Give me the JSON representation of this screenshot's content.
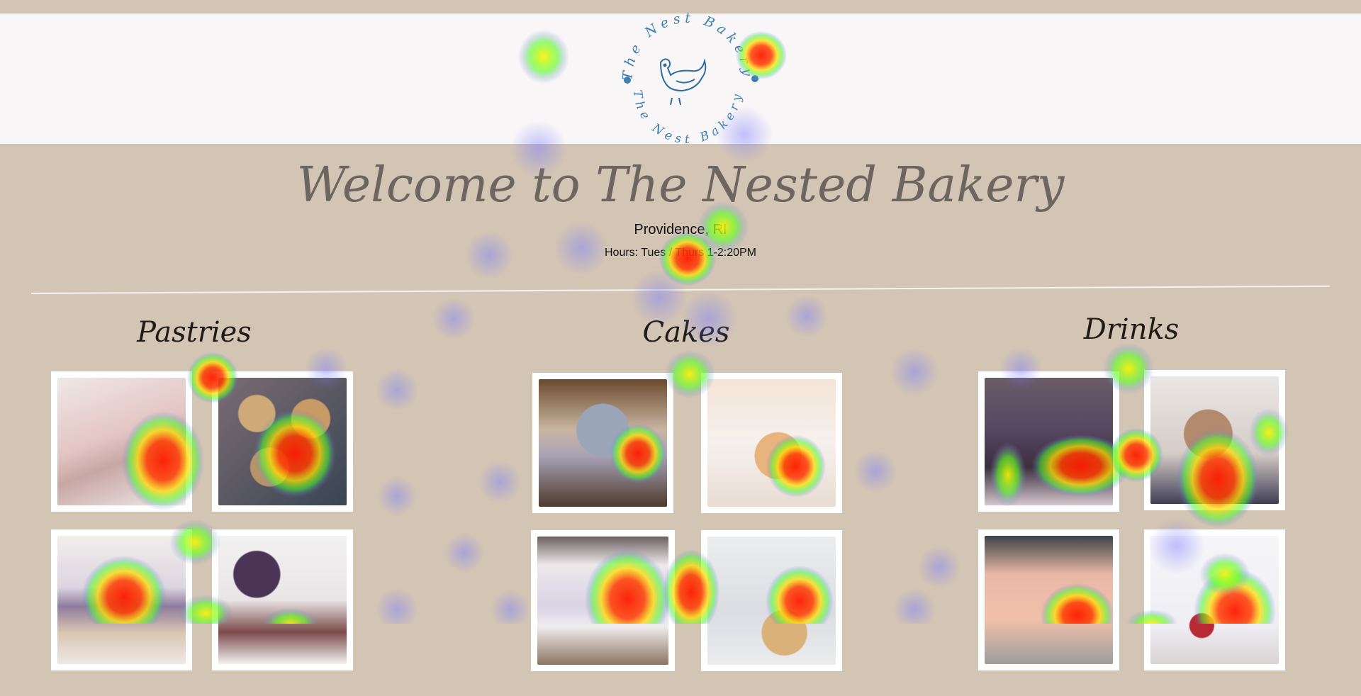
{
  "logo": {
    "top_text": "The Nest Bakery",
    "bottom_text": "The Nest Bakery",
    "icon": "hen-icon"
  },
  "hero": {
    "title": "Welcome to The Nested Bakery",
    "location": "Providence, RI",
    "hours": "Hours: Tues / Thurs 1-2:20PM"
  },
  "sections": [
    {
      "title": "Pastries"
    },
    {
      "title": "Cakes"
    },
    {
      "title": "Drinks"
    }
  ],
  "colors": {
    "background": "#d2c5b3",
    "header_bg": "#f8f6f6",
    "logo_blue": "#3f7fb1",
    "title_text": "#6d6660"
  }
}
